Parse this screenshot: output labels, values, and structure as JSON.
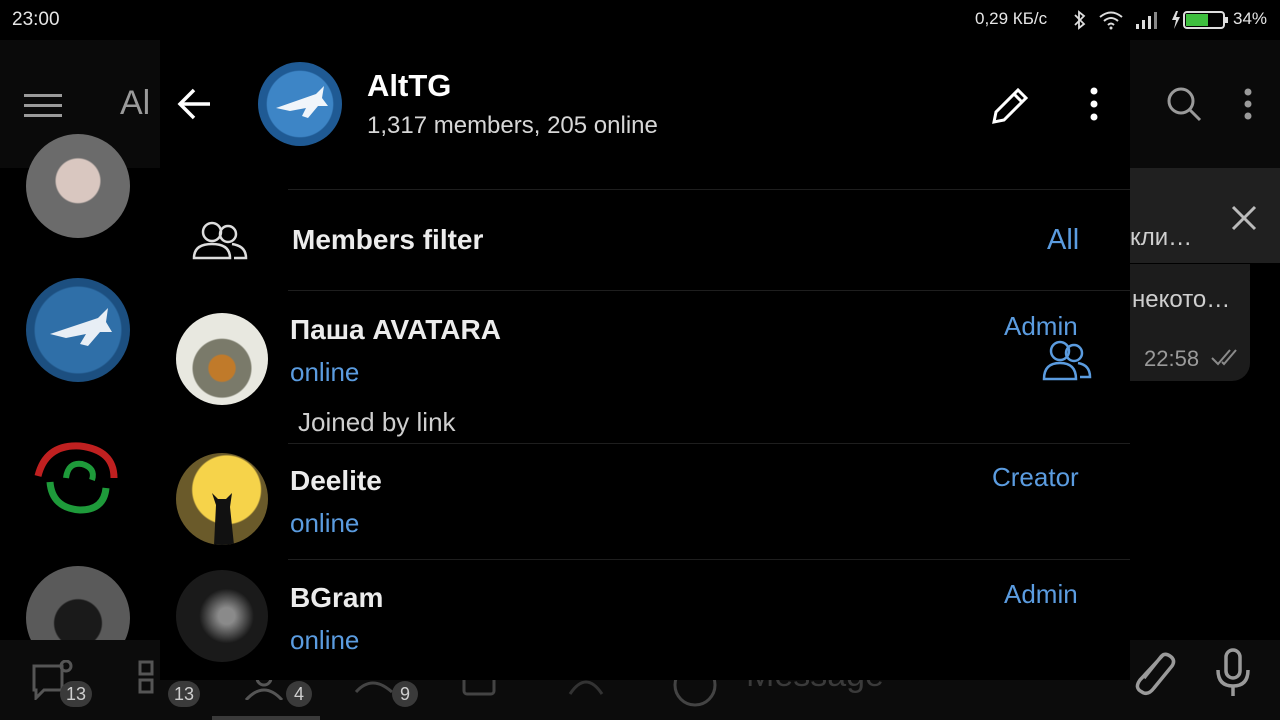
{
  "status_bar": {
    "time": "23:00",
    "speed": "0,29 КБ/с",
    "battery": "34%"
  },
  "background": {
    "title_fragment": "Al",
    "chat_snippets": [
      "кли…",
      "некото…"
    ],
    "chat_time": "22:58",
    "bottom_badges": [
      "13",
      "13",
      "4",
      "9"
    ],
    "message_placeholder": "Message"
  },
  "header": {
    "title": "AltTG",
    "subtitle": "1,317 members, 205 online"
  },
  "filter": {
    "label": "Members filter",
    "value": "All"
  },
  "members": [
    {
      "name": "Паша AVATARA",
      "status": "online",
      "role": "Admin",
      "note": "Joined by link"
    },
    {
      "name": "Deelite",
      "status": "online",
      "role": "Creator"
    },
    {
      "name": "BGram",
      "status": "online",
      "role": "Admin"
    }
  ],
  "colors": {
    "accent": "#5b9ce0",
    "background": "#000000",
    "text": "#ececec"
  }
}
